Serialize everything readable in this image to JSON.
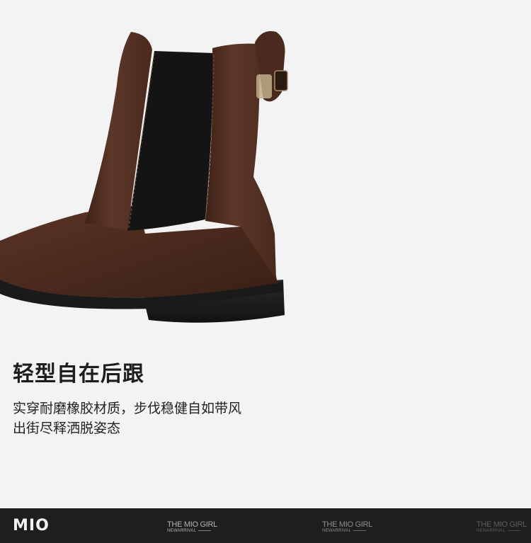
{
  "product": {
    "image_alt": "brown chelsea boot heel view",
    "headline": "轻型自在后跟",
    "description_lines": [
      "实穿耐磨橡胶材质，步伐稳健自如带风",
      "出街尽释洒脱姿态"
    ]
  },
  "footer": {
    "logo": "MIO",
    "watermarks": [
      {
        "title": "THE MIO GIRL",
        "subtitle": "NEWARRIVAL"
      },
      {
        "title": "THE MIO GIRL",
        "subtitle": "NEWARRIVAL"
      },
      {
        "title": "THE MIO GIRL",
        "subtitle": "NEWARRIVAL"
      }
    ]
  },
  "colors": {
    "background": "#f3f3f3",
    "footer": "#1e1e1e",
    "leather": "#4a2a1e",
    "elastic": "#141414",
    "sole": "#1b1b1b"
  }
}
